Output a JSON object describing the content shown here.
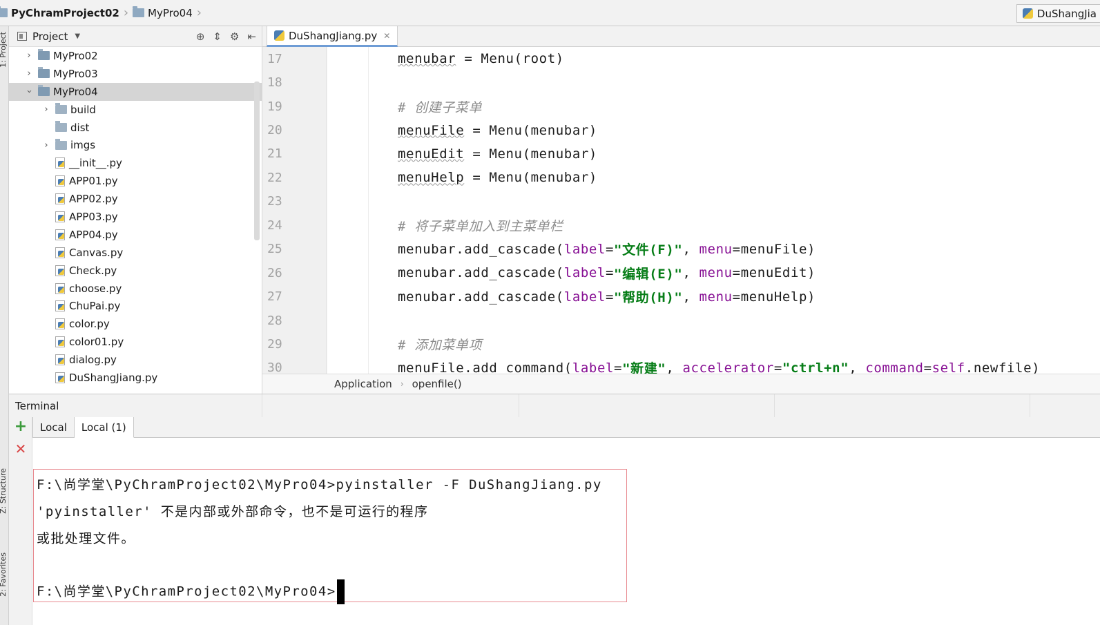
{
  "navbar": {
    "crumbs": [
      "PyChramProject02",
      "MyPro04"
    ],
    "run_config": "DuShangJia"
  },
  "left_strip": {
    "project_label": "1: Project",
    "structure_label": "Z: Structure",
    "favorites_label": "2: Favorites"
  },
  "project_panel": {
    "title": "Project",
    "tree": [
      {
        "label": "MyPro02",
        "kind": "dir",
        "level": 0,
        "expanded": false
      },
      {
        "label": "MyPro03",
        "kind": "dir",
        "level": 0,
        "expanded": false
      },
      {
        "label": "MyPro04",
        "kind": "dir",
        "level": 0,
        "expanded": true,
        "selected": true
      },
      {
        "label": "build",
        "kind": "dir",
        "level": 1,
        "expanded": false
      },
      {
        "label": "dist",
        "kind": "dir",
        "level": 1,
        "leaf": true
      },
      {
        "label": "imgs",
        "kind": "dir",
        "level": 1,
        "expanded": false
      },
      {
        "label": "__init__.py",
        "kind": "py",
        "level": 1
      },
      {
        "label": "APP01.py",
        "kind": "py",
        "level": 1
      },
      {
        "label": "APP02.py",
        "kind": "py",
        "level": 1
      },
      {
        "label": "APP03.py",
        "kind": "py",
        "level": 1
      },
      {
        "label": "APP04.py",
        "kind": "py",
        "level": 1
      },
      {
        "label": "Canvas.py",
        "kind": "py",
        "level": 1
      },
      {
        "label": "Check.py",
        "kind": "py",
        "level": 1
      },
      {
        "label": "choose.py",
        "kind": "py",
        "level": 1
      },
      {
        "label": "ChuPai.py",
        "kind": "py",
        "level": 1
      },
      {
        "label": "color.py",
        "kind": "py",
        "level": 1
      },
      {
        "label": "color01.py",
        "kind": "py",
        "level": 1
      },
      {
        "label": "dialog.py",
        "kind": "py",
        "level": 1
      },
      {
        "label": "DuShangJiang.py",
        "kind": "py",
        "level": 1
      }
    ]
  },
  "editor": {
    "tab_label": "DuShangJiang.py",
    "line_numbers": [
      "17",
      "18",
      "19",
      "20",
      "21",
      "22",
      "23",
      "24",
      "25",
      "26",
      "27",
      "28",
      "29",
      "30"
    ],
    "lines": [
      [
        {
          "t": "menubar",
          "c": "wavy"
        },
        {
          "t": " = Menu(root)",
          "c": ""
        }
      ],
      [],
      [
        {
          "t": "# 创建子菜单",
          "c": "cm"
        }
      ],
      [
        {
          "t": "menuFile",
          "c": "wavy"
        },
        {
          "t": " = Menu(menubar)",
          "c": ""
        }
      ],
      [
        {
          "t": "menuEdit",
          "c": "wavy"
        },
        {
          "t": " = Menu(menubar)",
          "c": ""
        }
      ],
      [
        {
          "t": "menuHelp",
          "c": "wavy"
        },
        {
          "t": " = Menu(menubar)",
          "c": ""
        }
      ],
      [],
      [
        {
          "t": "# 将子菜单加入到主菜单栏",
          "c": "cm"
        }
      ],
      [
        {
          "t": "menubar.add_cascade(",
          "c": ""
        },
        {
          "t": "label",
          "c": "kw"
        },
        {
          "t": "=",
          "c": ""
        },
        {
          "t": "\"文件(F)\"",
          "c": "str"
        },
        {
          "t": ", ",
          "c": ""
        },
        {
          "t": "menu",
          "c": "kw"
        },
        {
          "t": "=menuFile)",
          "c": ""
        }
      ],
      [
        {
          "t": "menubar.add_cascade(",
          "c": ""
        },
        {
          "t": "label",
          "c": "kw"
        },
        {
          "t": "=",
          "c": ""
        },
        {
          "t": "\"编辑(E)\"",
          "c": "str"
        },
        {
          "t": ", ",
          "c": ""
        },
        {
          "t": "menu",
          "c": "kw"
        },
        {
          "t": "=menuEdit)",
          "c": ""
        }
      ],
      [
        {
          "t": "menubar.add_cascade(",
          "c": ""
        },
        {
          "t": "label",
          "c": "kw"
        },
        {
          "t": "=",
          "c": ""
        },
        {
          "t": "\"帮助(H)\"",
          "c": "str"
        },
        {
          "t": ", ",
          "c": ""
        },
        {
          "t": "menu",
          "c": "kw"
        },
        {
          "t": "=menuHelp)",
          "c": ""
        }
      ],
      [],
      [
        {
          "t": "# 添加菜单项",
          "c": "cm"
        }
      ],
      [
        {
          "t": "menuFile.add_command(",
          "c": ""
        },
        {
          "t": "label",
          "c": "kw"
        },
        {
          "t": "=",
          "c": ""
        },
        {
          "t": "\"新建\"",
          "c": "str"
        },
        {
          "t": ", ",
          "c": ""
        },
        {
          "t": "accelerator",
          "c": "kw"
        },
        {
          "t": "=",
          "c": ""
        },
        {
          "t": "\"ctrl+n\"",
          "c": "str"
        },
        {
          "t": ", ",
          "c": ""
        },
        {
          "t": "command",
          "c": "kw"
        },
        {
          "t": "=",
          "c": ""
        },
        {
          "t": "self",
          "c": "kw"
        },
        {
          "t": ".newfile)",
          "c": ""
        }
      ]
    ],
    "breadcrumb": [
      "Application",
      "openfile()"
    ]
  },
  "terminal": {
    "title": "Terminal",
    "tabs": [
      "Local",
      "Local (1)"
    ],
    "lines": [
      "F:\\尚学堂\\PyChramProject02\\MyPro04>pyinstaller -F DuShangJiang.py",
      "'pyinstaller' 不是内部或外部命令，也不是可运行的程序",
      "或批处理文件。",
      "",
      "F:\\尚学堂\\PyChramProject02\\MyPro04>"
    ]
  },
  "colors": {
    "highlight_border": "#e8898f",
    "comment": "#8c8c8c",
    "keyword_arg": "#871094",
    "string": "#067d17"
  }
}
